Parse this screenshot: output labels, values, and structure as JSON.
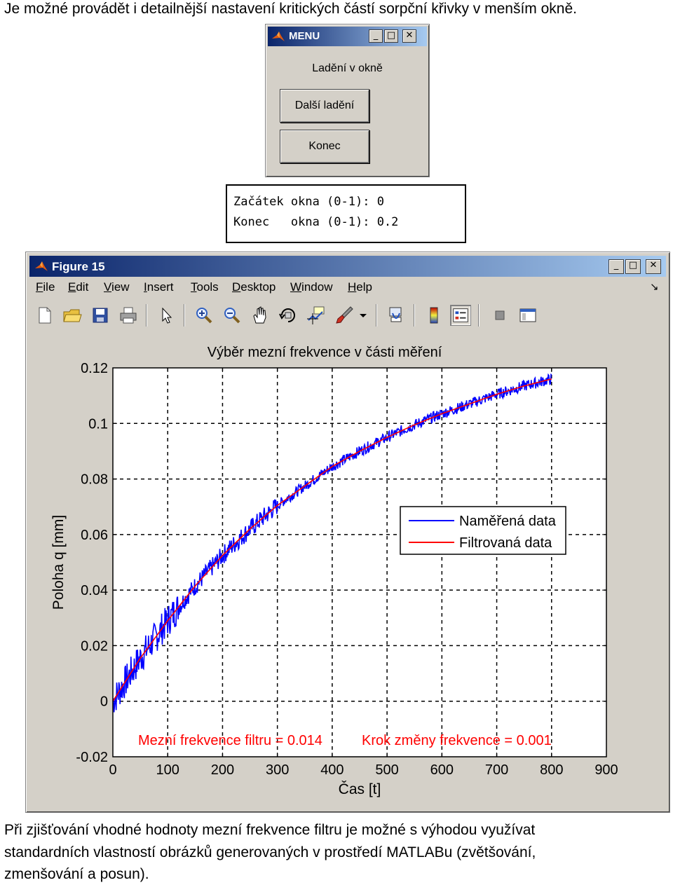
{
  "document": {
    "intro_text": "Je možné provádět i detailnější nastavení kritických částí sorpční křivky v menším okně.",
    "footer_line1": "Při zjišťování vhodné hodnoty mezní frekvence filtru je možné s výhodou využívat",
    "footer_line2": "standardních vlastností obrázků generovaných v prostředí MATLABu (zvětšování,",
    "footer_line3": "zmenšování a posun)."
  },
  "menu_window": {
    "title": "MENU",
    "label": "Ladění v okně",
    "buttons": [
      "Další ladění",
      "Konec"
    ],
    "title_buttons": [
      "minimize",
      "maximize",
      "close"
    ]
  },
  "console": {
    "line1": "Začátek okna (0-1): 0",
    "line2": "Konec   okna (0-1): 0.2"
  },
  "figure_window": {
    "title": "Figure 15",
    "menu": [
      "File",
      "Edit",
      "View",
      "Insert",
      "Tools",
      "Desktop",
      "Window",
      "Help"
    ],
    "menu_shortcuts": [
      "F",
      "E",
      "V",
      "I",
      "T",
      "D",
      "W",
      "H"
    ],
    "dock_arrow": "↘",
    "toolbar_icons": [
      "new-figure-icon",
      "open-file-icon",
      "save-icon",
      "print-icon",
      "edit-plot-arrow-icon",
      "zoom-in-icon",
      "zoom-out-icon",
      "pan-hand-icon",
      "rotate-3d-icon",
      "data-cursor-icon",
      "brush-icon",
      "link-plot-icon",
      "insert-colorbar-icon",
      "insert-legend-icon",
      "hide-plot-tools-icon",
      "show-plot-tools-icon"
    ]
  },
  "chart_data": {
    "type": "line",
    "title": "Výběr mezní frekvence v části měření",
    "xlabel": "Čas [t]",
    "ylabel": "Poloha q [mm]",
    "xlim": [
      0,
      900
    ],
    "ylim": [
      -0.02,
      0.12
    ],
    "xticks": [
      "0",
      "100",
      "200",
      "300",
      "400",
      "500",
      "600",
      "700",
      "800",
      "900"
    ],
    "yticks": [
      "-0.02",
      "0",
      "0.02",
      "0.04",
      "0.06",
      "0.08",
      "0.1",
      "0.12"
    ],
    "grid": true,
    "legend_position": "right",
    "series": [
      {
        "name": "Naměřená data",
        "color": "#0000ff",
        "x": [
          0,
          50,
          100,
          150,
          200,
          250,
          300,
          350,
          400,
          450,
          500,
          550,
          600,
          650,
          700,
          750,
          800
        ],
        "y": [
          0.0,
          0.0155,
          0.029,
          0.0415,
          0.0525,
          0.062,
          0.0705,
          0.0775,
          0.0845,
          0.09,
          0.095,
          0.0995,
          0.1035,
          0.107,
          0.1105,
          0.1135,
          0.116
        ]
      },
      {
        "name": "Filtrovaná data",
        "color": "#ff0000",
        "x": [
          0,
          50,
          100,
          150,
          200,
          250,
          300,
          350,
          400,
          450,
          500,
          550,
          600,
          650,
          700,
          750,
          800
        ],
        "y": [
          0.0,
          0.0155,
          0.029,
          0.0415,
          0.0525,
          0.062,
          0.0705,
          0.0775,
          0.0845,
          0.09,
          0.095,
          0.0995,
          0.1035,
          0.107,
          0.1105,
          0.1135,
          0.116
        ]
      }
    ],
    "annotations": [
      "Mezní frekvence filtru = 0.014",
      "Krok změny frekvence = 0.001"
    ],
    "annotation_color": "#ff0000"
  }
}
